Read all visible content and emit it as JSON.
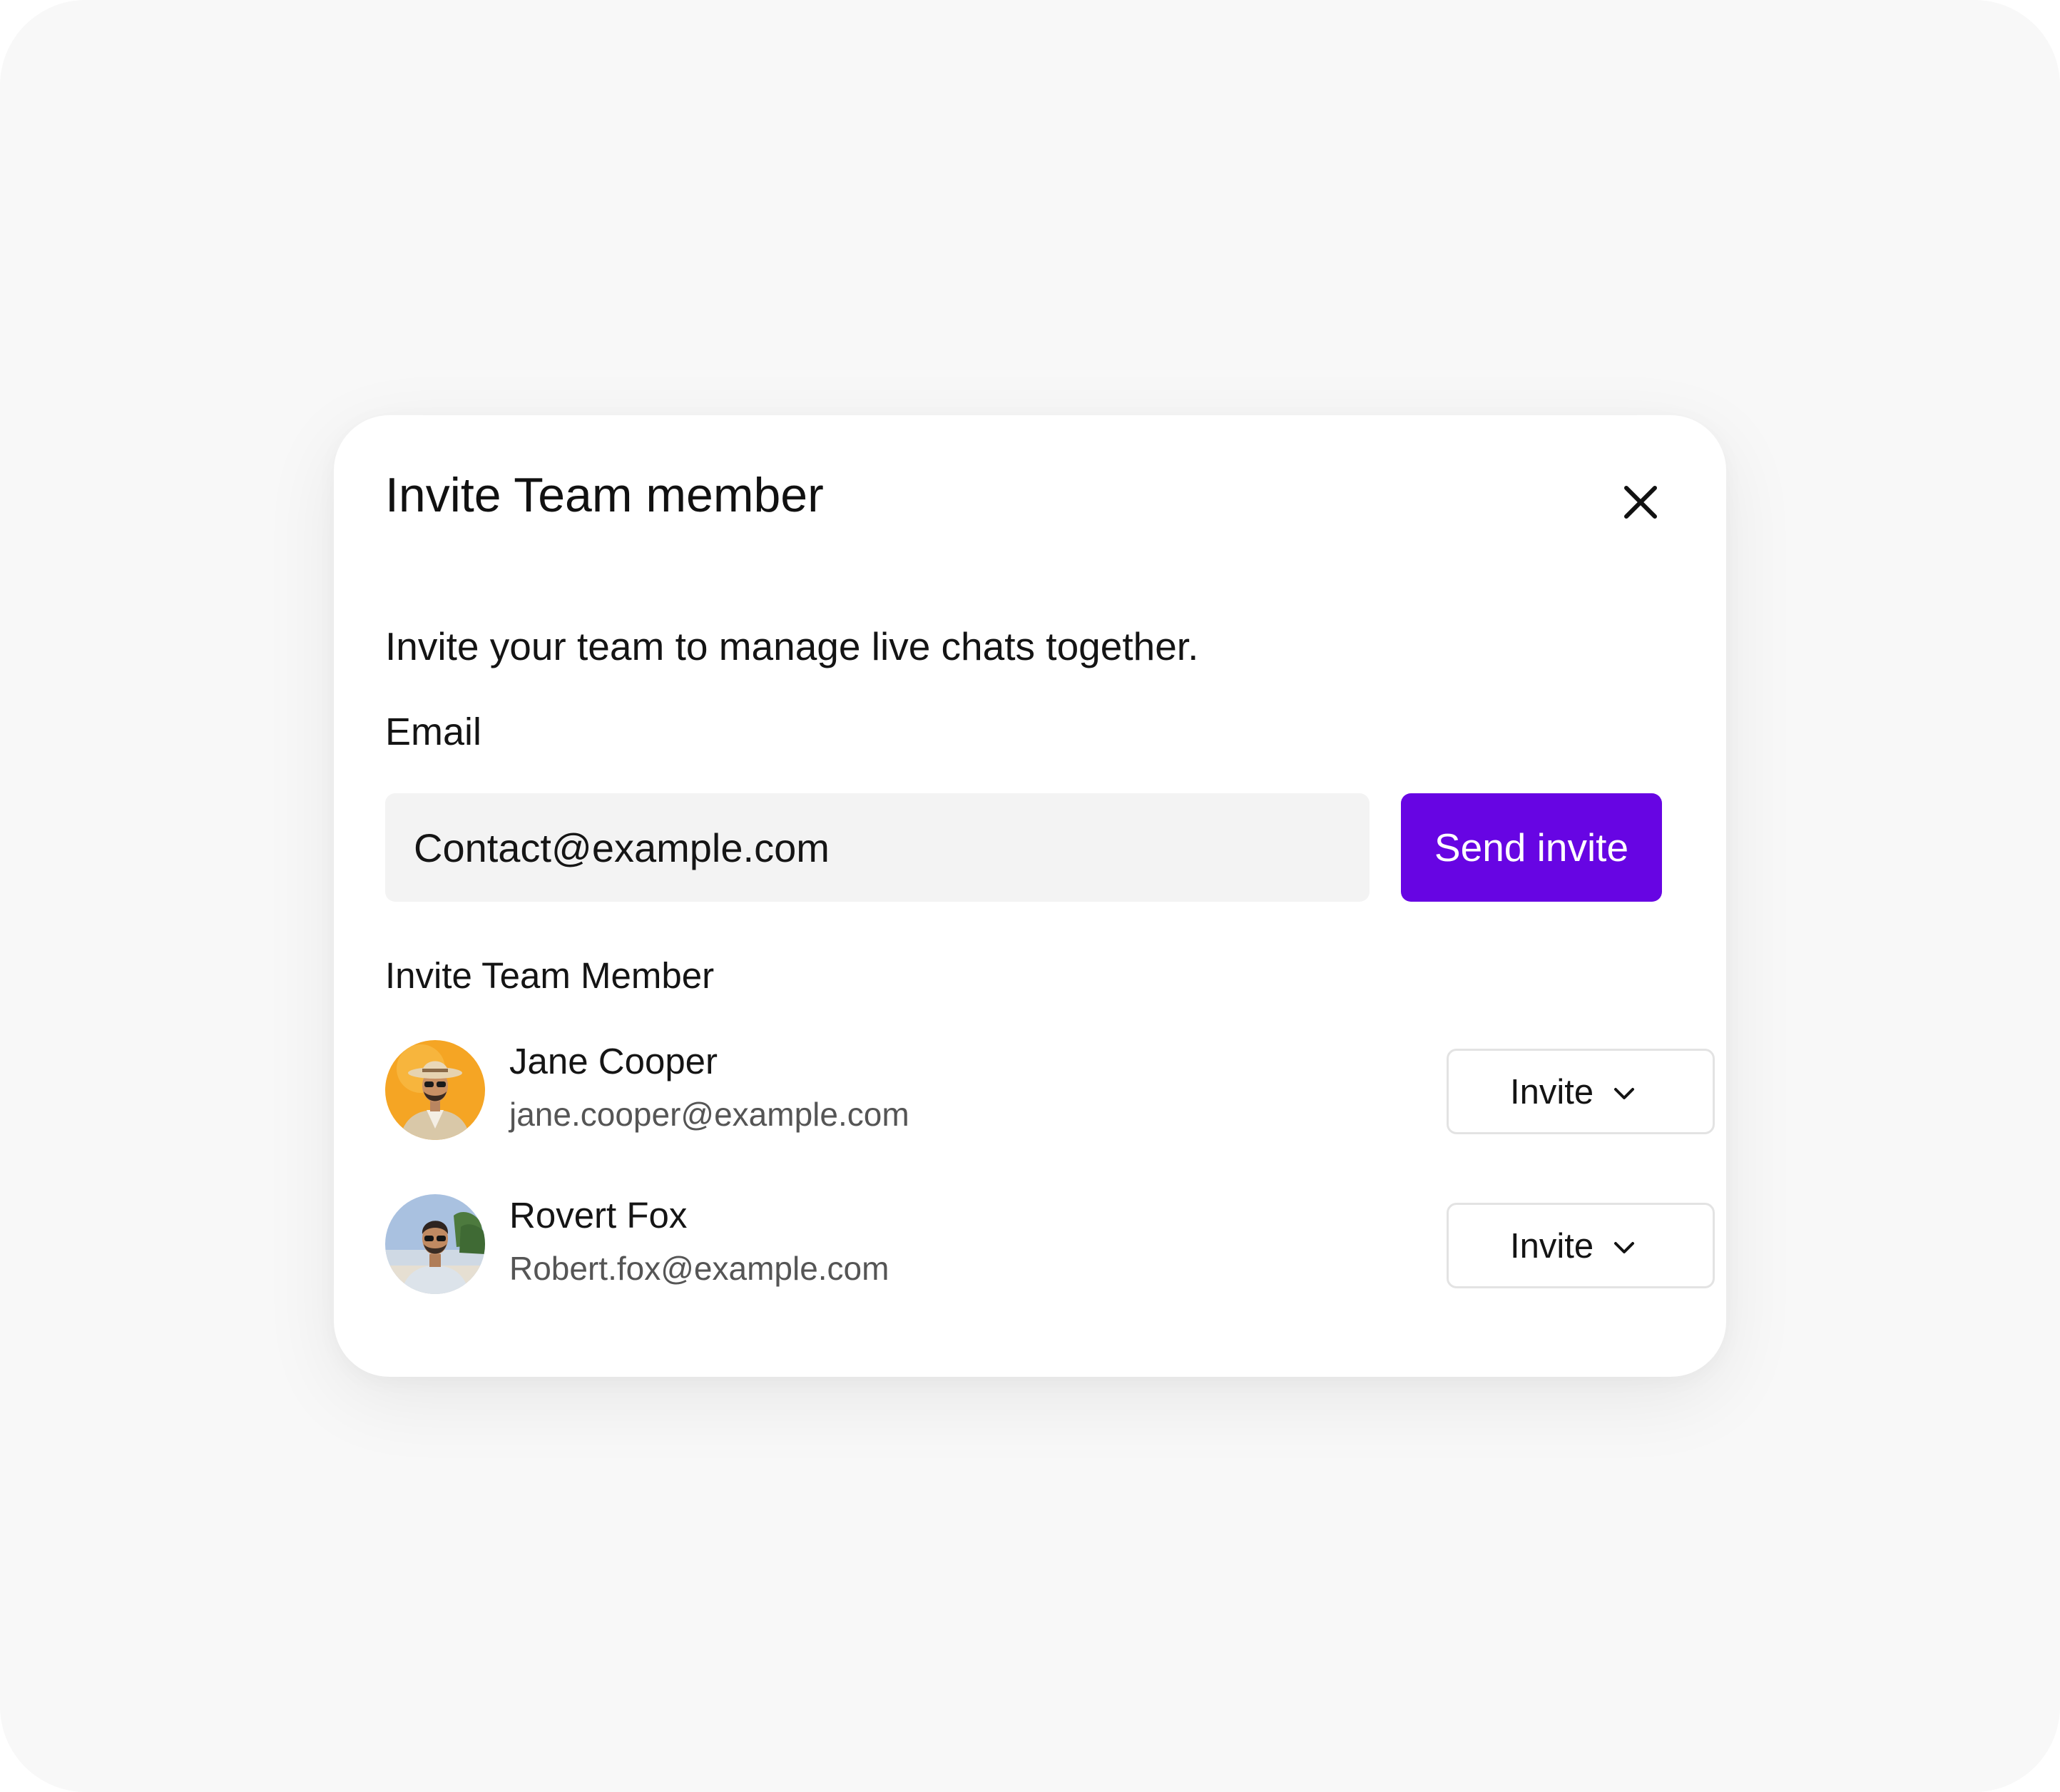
{
  "modal": {
    "title": "Invite Team member",
    "close_icon": "close-icon",
    "subtitle": "Invite your team to manage live chats together.",
    "email_label": "Email",
    "email_value": "Contact@example.com",
    "send_button_label": "Send invite",
    "section_label": "Invite Team Member",
    "members": [
      {
        "name": "Jane Cooper",
        "email": "jane.cooper@example.com",
        "action_label": "Invite",
        "avatar_icon": "avatar-photo",
        "avatar_bg": "#f5a524"
      },
      {
        "name": "Rovert Fox",
        "email": "Robert.fox@example.com",
        "action_label": "Invite",
        "avatar_icon": "avatar-photo",
        "avatar_bg": "#a9c1e0"
      }
    ]
  },
  "colors": {
    "accent": "#6705e3",
    "page_background": "#f8f8f8",
    "input_background": "#f3f3f3",
    "secondary_text": "#555555"
  }
}
